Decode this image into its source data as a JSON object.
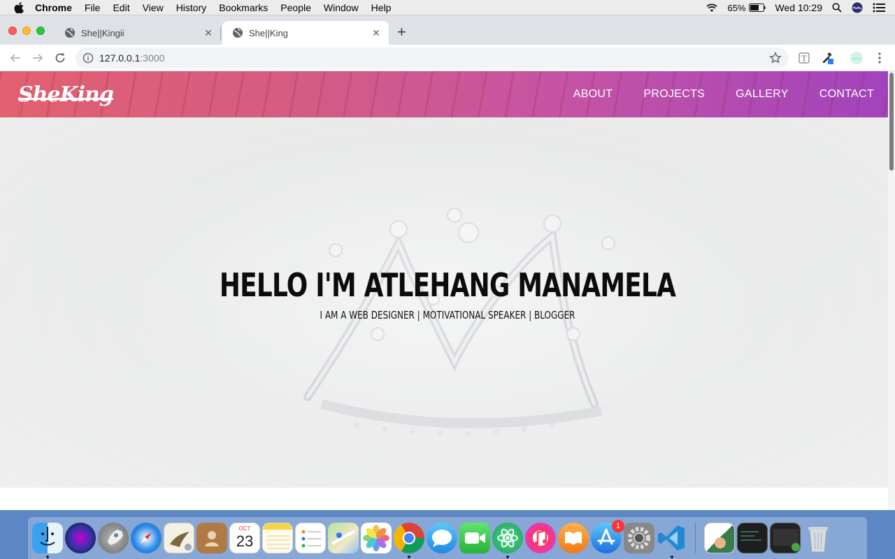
{
  "menubar": {
    "app_name": "Chrome",
    "items": [
      "File",
      "Edit",
      "View",
      "History",
      "Bookmarks",
      "People",
      "Window",
      "Help"
    ],
    "battery": "65%",
    "clock": "Wed 10:29"
  },
  "browser": {
    "tabs": [
      {
        "title": "She||Kingii",
        "active": false
      },
      {
        "title": "She||King",
        "active": true
      }
    ],
    "url_host": "127.0.0.1",
    "url_port": ":3000"
  },
  "site": {
    "logo": "SheKing",
    "nav": [
      "ABOUT",
      "PROJECTS",
      "GALLERY",
      "CONTACT"
    ],
    "hero_title": "HELLO I'M ATLEHANG MANAMELA",
    "hero_subtitle": "I AM A WEB DESIGNER | MOTIVATIONAL SPEAKER | BLOGGER"
  },
  "dock": {
    "calendar_month": "OCT",
    "calendar_day": "23",
    "app_store_badge": "1"
  },
  "colors": {
    "header_start": "#e2606f",
    "header_end": "#a143bd",
    "dock_bg": "#5d86c4"
  }
}
